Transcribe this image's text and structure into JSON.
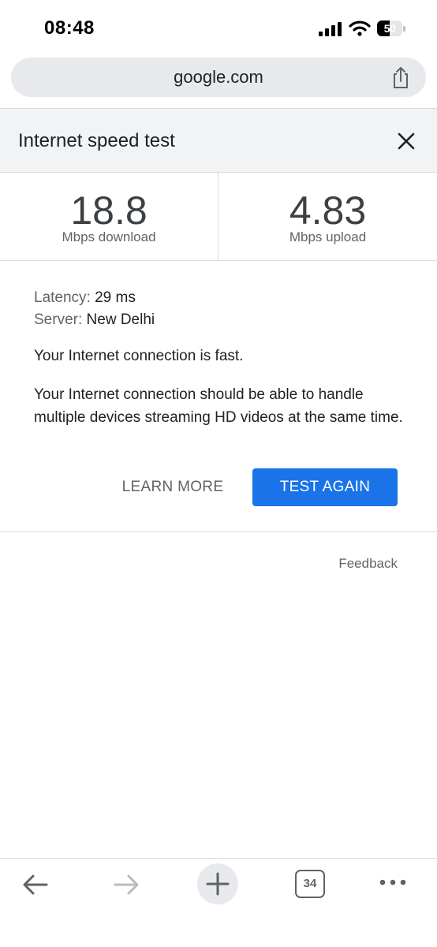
{
  "status_bar": {
    "time": "08:48",
    "battery_level": "50"
  },
  "browser": {
    "url": "google.com"
  },
  "speed_test": {
    "title": "Internet speed test",
    "download": {
      "value": "18.8",
      "label": "Mbps download"
    },
    "upload": {
      "value": "4.83",
      "label": "Mbps upload"
    },
    "latency_label": "Latency:",
    "latency_value": "29 ms",
    "server_label": "Server:",
    "server_value": "New Delhi",
    "message": "Your Internet connection is fast.",
    "description": "Your Internet connection should be able to handle multiple devices streaming HD videos at the same time.",
    "learn_more_label": "LEARN MORE",
    "test_again_label": "TEST AGAIN"
  },
  "feedback_label": "Feedback",
  "toolbar": {
    "tab_count": "34"
  },
  "colors": {
    "accent": "#1a73e8",
    "header_bg": "#f1f3f4",
    "url_bar_bg": "#e7e9ec"
  }
}
